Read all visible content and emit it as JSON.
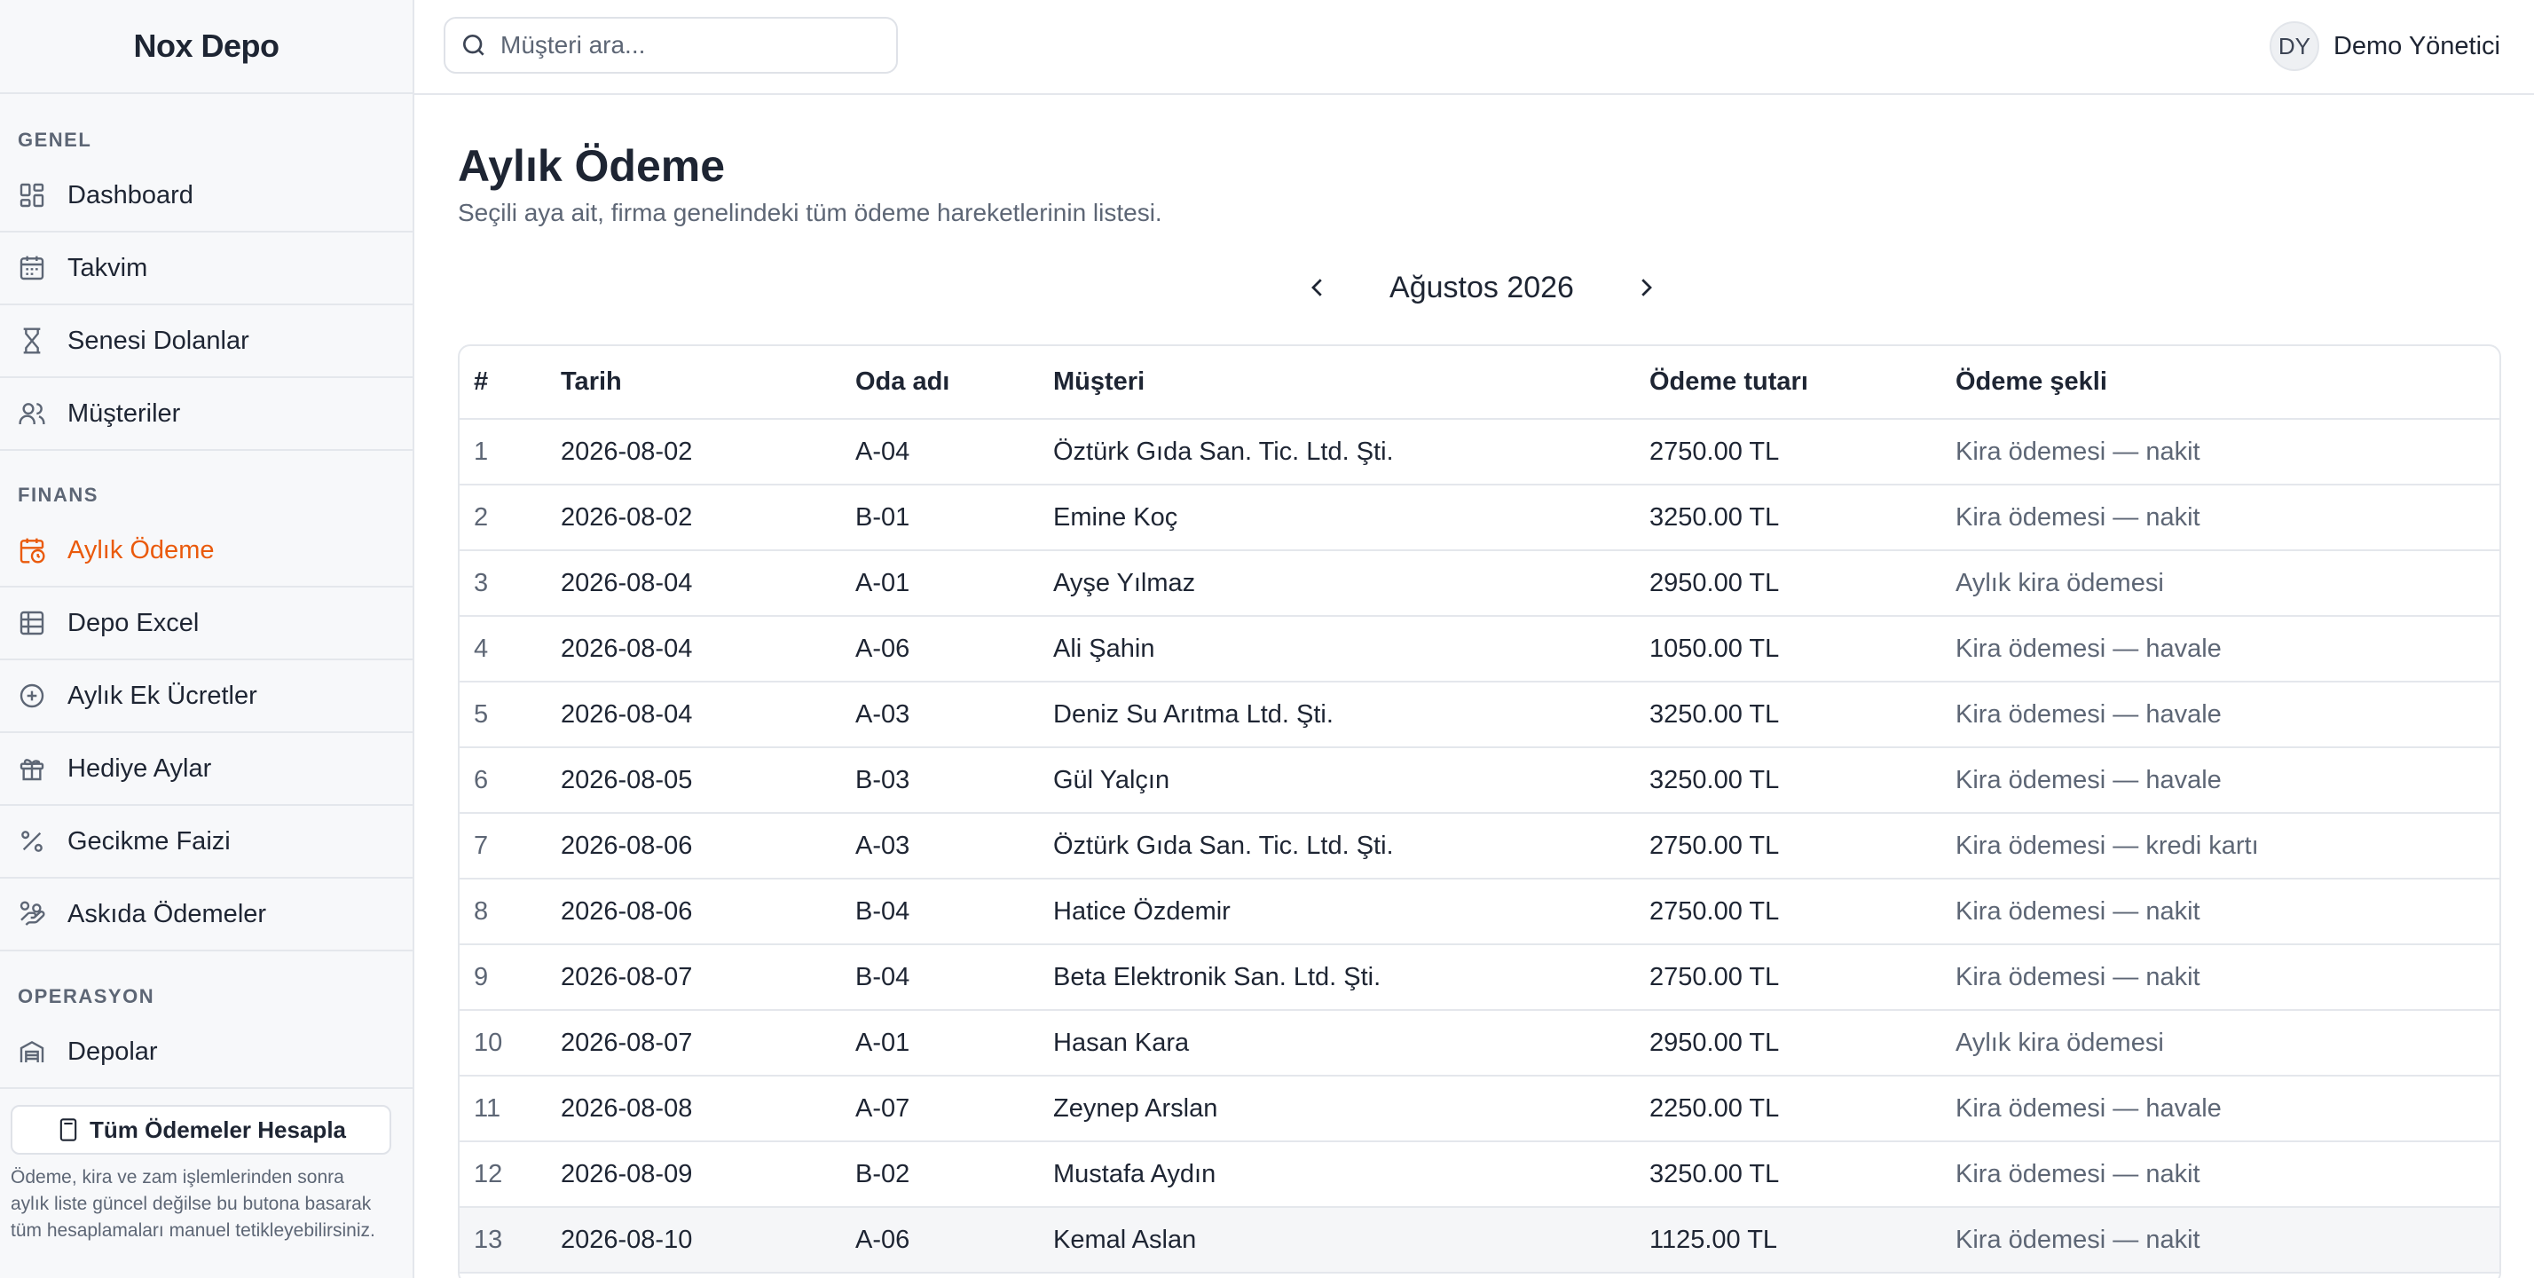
{
  "app": {
    "brand": "Nox Depo"
  },
  "topbar": {
    "search_placeholder": "Müşteri ara...",
    "user_initials": "DY",
    "user_name": "Demo Yönetici"
  },
  "sidebar": {
    "sections": {
      "genel": "GENEL",
      "finans": "FINANS",
      "operasyon": "OPERASYON"
    },
    "items": [
      {
        "label": "Dashboard",
        "icon": "dashboard-icon"
      },
      {
        "label": "Takvim",
        "icon": "calendar-icon"
      },
      {
        "label": "Senesi Dolanlar",
        "icon": "hourglass-icon"
      },
      {
        "label": "Müşteriler",
        "icon": "users-icon"
      },
      {
        "label": "Aylık Ödeme",
        "icon": "calendar-clock-icon",
        "active": true
      },
      {
        "label": "Depo Excel",
        "icon": "table-icon"
      },
      {
        "label": "Aylık Ek Ücretler",
        "icon": "plus-circle-icon"
      },
      {
        "label": "Hediye Aylar",
        "icon": "gift-icon"
      },
      {
        "label": "Gecikme Faizi",
        "icon": "percent-icon"
      },
      {
        "label": "Askıda Ödemeler",
        "icon": "hand-coins-icon"
      },
      {
        "label": "Depolar",
        "icon": "warehouse-icon"
      }
    ],
    "calc_button": "Tüm Ödemeler Hesapla",
    "calc_note": "Ödeme, kira ve zam işlemlerinden sonra aylık liste güncel değilse bu butona basarak tüm hesaplamaları manuel tetikleyebilirsiniz."
  },
  "main": {
    "title": "Aylık Ödeme",
    "subtitle": "Seçili aya ait, firma genelindeki tüm ödeme hareketlerinin listesi.",
    "month": "Ağustos 2026"
  },
  "table": {
    "headers": [
      "#",
      "Tarih",
      "Oda adı",
      "Müşteri",
      "Ödeme tutarı",
      "Ödeme şekli"
    ],
    "rows": [
      [
        "1",
        "2026-08-02",
        "A-04",
        "Öztürk Gıda San. Tic. Ltd. Şti.",
        "2750.00 TL",
        "Kira ödemesi — nakit"
      ],
      [
        "2",
        "2026-08-02",
        "B-01",
        "Emine Koç",
        "3250.00 TL",
        "Kira ödemesi — nakit"
      ],
      [
        "3",
        "2026-08-04",
        "A-01",
        "Ayşe Yılmaz",
        "2950.00 TL",
        "Aylık kira ödemesi"
      ],
      [
        "4",
        "2026-08-04",
        "A-06",
        "Ali Şahin",
        "1050.00 TL",
        "Kira ödemesi — havale"
      ],
      [
        "5",
        "2026-08-04",
        "A-03",
        "Deniz Su Arıtma Ltd. Şti.",
        "3250.00 TL",
        "Kira ödemesi — havale"
      ],
      [
        "6",
        "2026-08-05",
        "B-03",
        "Gül Yalçın",
        "3250.00 TL",
        "Kira ödemesi — havale"
      ],
      [
        "7",
        "2026-08-06",
        "A-03",
        "Öztürk Gıda San. Tic. Ltd. Şti.",
        "2750.00 TL",
        "Kira ödemesi — kredi kartı"
      ],
      [
        "8",
        "2026-08-06",
        "B-04",
        "Hatice Özdemir",
        "2750.00 TL",
        "Kira ödemesi — nakit"
      ],
      [
        "9",
        "2026-08-07",
        "B-04",
        "Beta Elektronik San. Ltd. Şti.",
        "2750.00 TL",
        "Kira ödemesi — nakit"
      ],
      [
        "10",
        "2026-08-07",
        "A-01",
        "Hasan Kara",
        "2950.00 TL",
        "Aylık kira ödemesi"
      ],
      [
        "11",
        "2026-08-08",
        "A-07",
        "Zeynep Arslan",
        "2250.00 TL",
        "Kira ödemesi — havale"
      ],
      [
        "12",
        "2026-08-09",
        "B-02",
        "Mustafa Aydın",
        "3250.00 TL",
        "Kira ödemesi — nakit"
      ],
      [
        "13",
        "2026-08-10",
        "A-06",
        "Kemal Aslan",
        "1125.00 TL",
        "Kira ödemesi — nakit"
      ]
    ],
    "hovered_row": 13
  },
  "colors": {
    "accent": "#ea5a0c",
    "text": "#1e2533",
    "muted": "#5d6675",
    "border": "#e4e7ec",
    "sidebar_bg": "#f7f8fa"
  }
}
